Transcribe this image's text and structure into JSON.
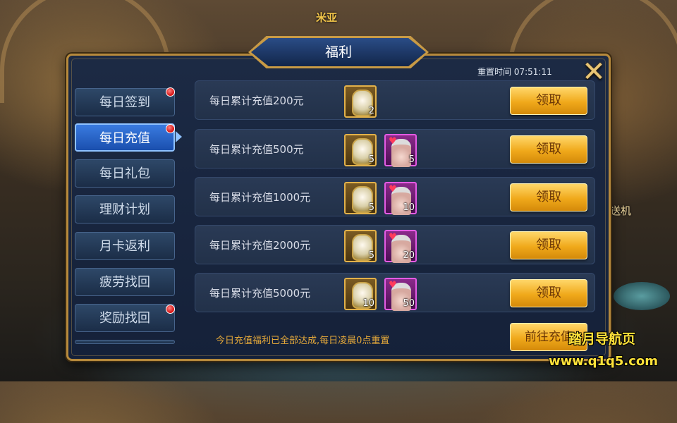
{
  "scene": {
    "npc_name_top": "米亚",
    "npc_label_right": "亚的传送机"
  },
  "dialog": {
    "title": "福利",
    "reset_time": "重置时间 07:51:11",
    "close_icon": "close-x-icon"
  },
  "sidebar": {
    "items": [
      {
        "label": "每日签到",
        "badge": true
      },
      {
        "label": "每日充值",
        "badge": true,
        "active": true
      },
      {
        "label": "每日礼包",
        "badge": false
      },
      {
        "label": "理财计划",
        "badge": false
      },
      {
        "label": "月卡返利",
        "badge": false
      },
      {
        "label": "疲劳找回",
        "badge": false
      },
      {
        "label": "奖励找回",
        "badge": true
      }
    ]
  },
  "rewards": [
    {
      "label": "每日累计充值200元",
      "items": [
        {
          "icon": "vase-icon",
          "qty": "2"
        }
      ],
      "button": "领取"
    },
    {
      "label": "每日累计充值500元",
      "items": [
        {
          "icon": "vase-icon",
          "qty": "5"
        },
        {
          "icon": "hero-card-icon",
          "qty": "5"
        }
      ],
      "button": "领取"
    },
    {
      "label": "每日累计充值1000元",
      "items": [
        {
          "icon": "vase-icon",
          "qty": "5"
        },
        {
          "icon": "hero-card-icon",
          "qty": "10"
        }
      ],
      "button": "领取"
    },
    {
      "label": "每日累计充值2000元",
      "items": [
        {
          "icon": "vase-icon",
          "qty": "5"
        },
        {
          "icon": "hero-card-icon",
          "qty": "20"
        }
      ],
      "button": "领取"
    },
    {
      "label": "每日累计充值5000元",
      "items": [
        {
          "icon": "vase-icon",
          "qty": "10"
        },
        {
          "icon": "hero-card-icon",
          "qty": "50"
        }
      ],
      "button": "领取"
    }
  ],
  "footer": {
    "note": "今日充值福利已全部达成,每日凌晨0点重置",
    "goto_button": "前往充值"
  },
  "watermark": {
    "line1": "踏月导航页",
    "line2": "www.q1q5.com"
  },
  "colors": {
    "panel_border": "#b78a3c",
    "panel_bg": "#1c2a44",
    "button_gold": "#f0a91b",
    "active_tab": "#3a7be0",
    "badge_red": "#d51010",
    "note_orange": "#e5a93a"
  }
}
